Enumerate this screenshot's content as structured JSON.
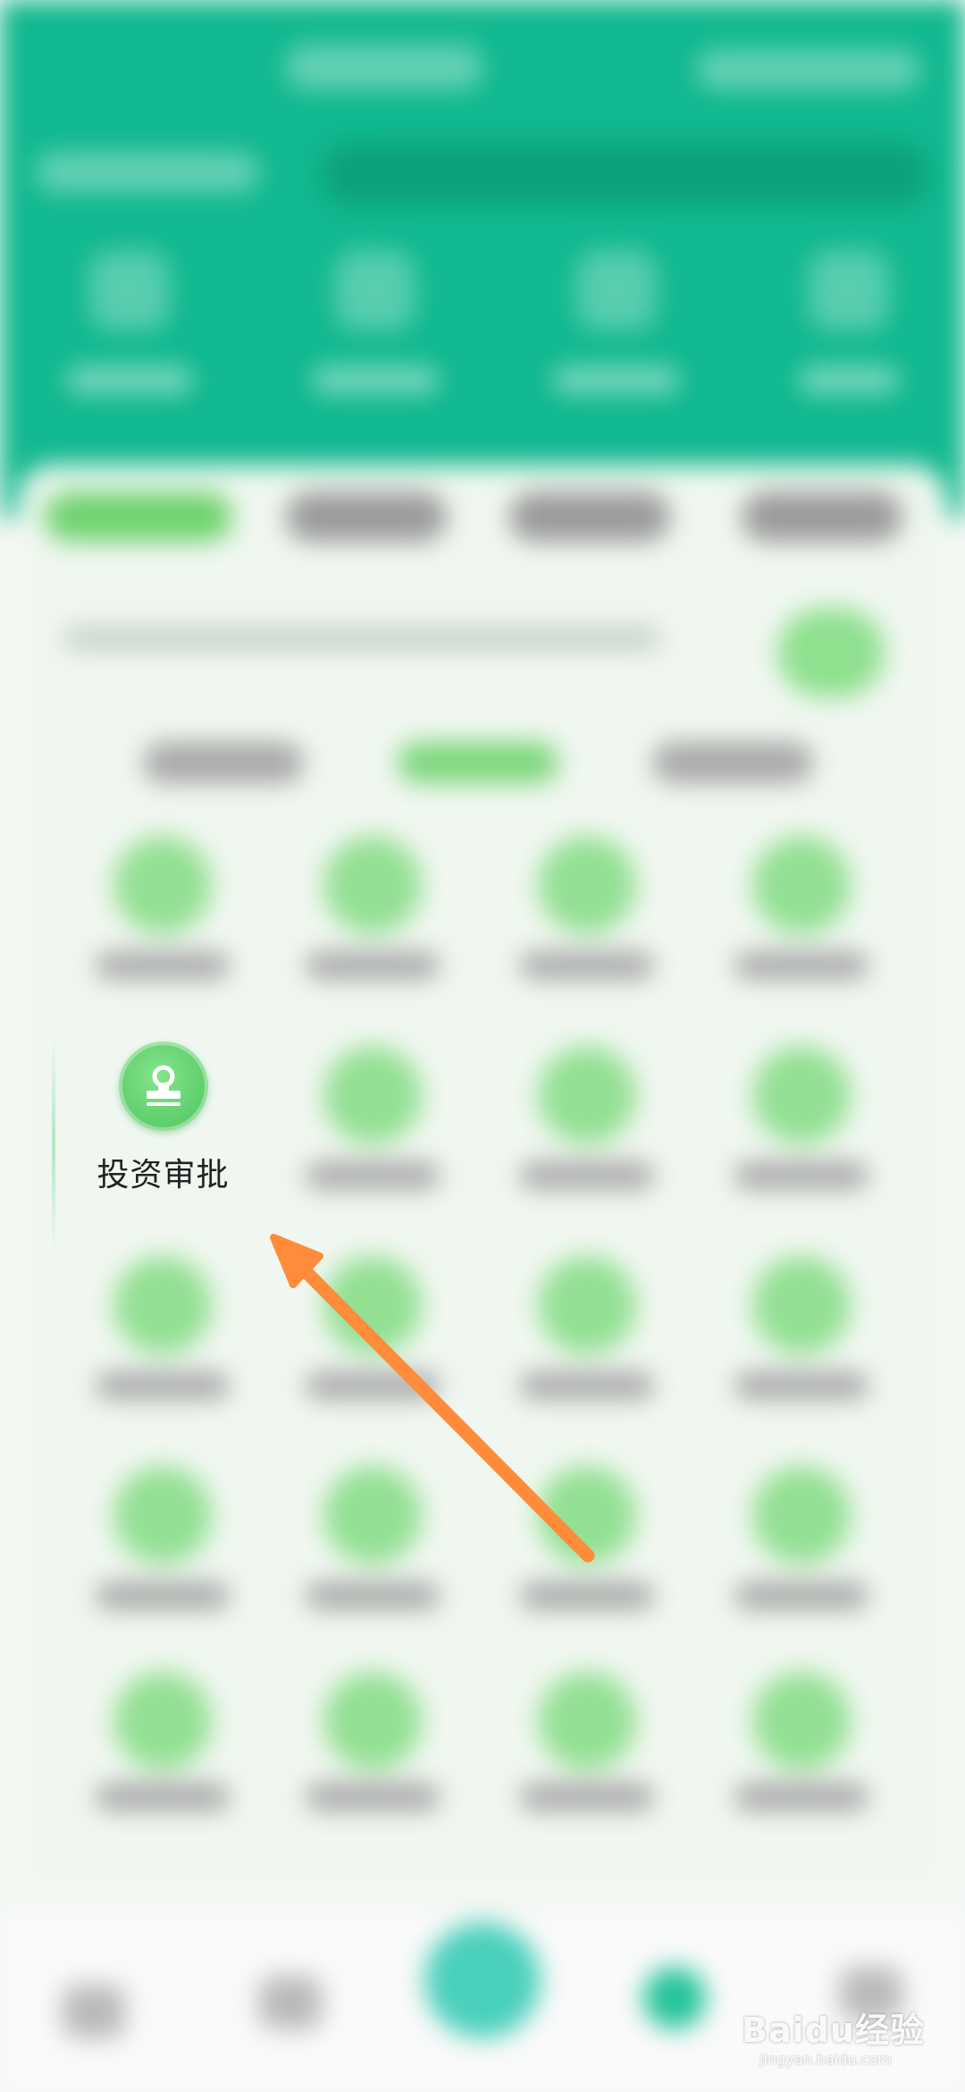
{
  "highlighted_item": {
    "label": "投资审批",
    "icon": "stamp-icon",
    "icon_color": "#5ccd6a"
  },
  "annotation": {
    "arrow_color": "#ff8c3a"
  },
  "theme": {
    "header_color": "#11b88f",
    "tab_active_color": "#6fd36f",
    "nav_center_color": "#49d0bb"
  },
  "watermark": {
    "main": "Baidu经验",
    "sub": "jingyan.baidu.com"
  }
}
